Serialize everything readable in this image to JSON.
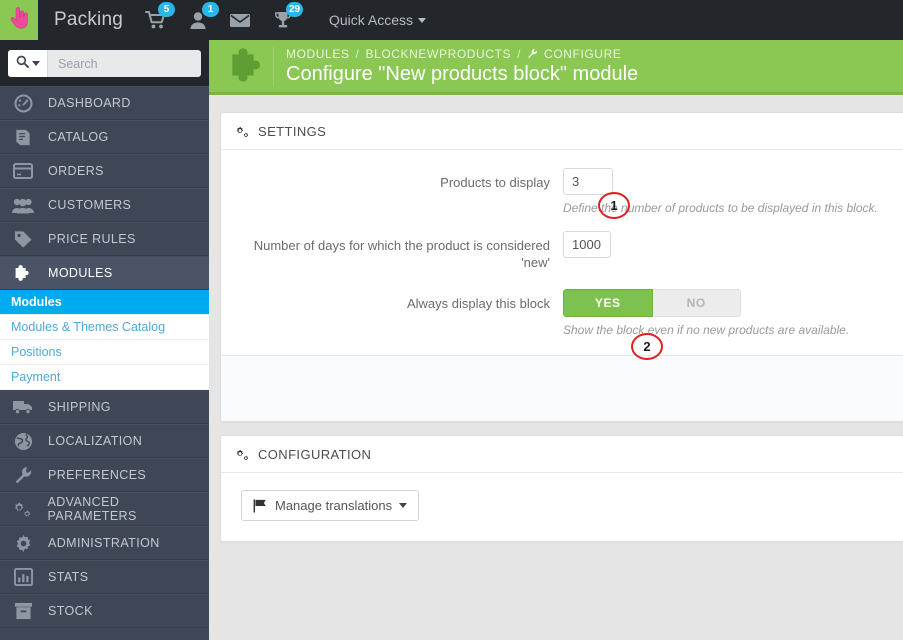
{
  "colors": {
    "topbar": "#23262b",
    "sidebar": "#3f4757",
    "brand_green": "#8bc753",
    "accent_blue": "#00aaf0",
    "badge_blue": "#29b6e8",
    "annotation_red": "#e02020",
    "switch_on_green": "#7dc24f"
  },
  "topbar": {
    "logo_icon": "hand-cursor-icon",
    "shop_name": "Packing",
    "icons": [
      {
        "name": "cart-icon",
        "badge": "5"
      },
      {
        "name": "person-icon",
        "badge": "1"
      },
      {
        "name": "envelope-icon",
        "badge": ""
      },
      {
        "name": "trophy-icon",
        "badge": "29"
      }
    ],
    "quick_access_label": "Quick Access"
  },
  "sidebar": {
    "search": {
      "placeholder": "Search",
      "value": "",
      "icon": "search-icon"
    },
    "items": [
      {
        "label": "DASHBOARD",
        "icon": "dashboard-icon",
        "active": false
      },
      {
        "label": "CATALOG",
        "icon": "book-icon",
        "active": false
      },
      {
        "label": "ORDERS",
        "icon": "card-icon",
        "active": false
      },
      {
        "label": "CUSTOMERS",
        "icon": "people-icon",
        "active": false
      },
      {
        "label": "PRICE RULES",
        "icon": "tag-icon",
        "active": false
      },
      {
        "label": "MODULES",
        "icon": "puzzle-icon",
        "active": true
      },
      {
        "label": "SHIPPING",
        "icon": "truck-icon",
        "active": false
      },
      {
        "label": "LOCALIZATION",
        "icon": "globe-icon",
        "active": false
      },
      {
        "label": "PREFERENCES",
        "icon": "wrench-icon",
        "active": false
      },
      {
        "label": "ADVANCED PARAMETERS",
        "icon": "gears-icon",
        "active": false
      },
      {
        "label": "ADMINISTRATION",
        "icon": "gear-icon",
        "active": false
      },
      {
        "label": "STATS",
        "icon": "bar-chart-icon",
        "active": false
      },
      {
        "label": "STOCK",
        "icon": "box-icon",
        "active": false
      }
    ],
    "submenu": [
      {
        "label": "Modules",
        "active": true
      },
      {
        "label": "Modules & Themes Catalog",
        "active": false
      },
      {
        "label": "Positions",
        "active": false
      },
      {
        "label": "Payment",
        "active": false
      }
    ]
  },
  "header": {
    "icon": "puzzle-icon",
    "breadcrumb": [
      {
        "label": "MODULES",
        "icon": ""
      },
      {
        "label": "BLOCKNEWPRODUCTS",
        "icon": ""
      },
      {
        "label": "CONFIGURE",
        "icon": "wrench-icon"
      }
    ],
    "separator": "/",
    "title": "Configure \"New products block\" module"
  },
  "settings_panel": {
    "icon": "gears-icon",
    "title": "SETTINGS",
    "fields": [
      {
        "label": "Products to display",
        "value": "3",
        "help": "Define the number of products to be displayed in this block.",
        "type": "number"
      },
      {
        "label": "Number of days for which the product is considered 'new'",
        "value": "1000",
        "help": "",
        "type": "number"
      },
      {
        "label": "Always display this block",
        "type": "switch",
        "on_label": "YES",
        "off_label": "NO",
        "value": "YES",
        "help": "Show the block even if no new products are available."
      }
    ]
  },
  "configuration_panel": {
    "icon": "gears-icon",
    "title": "CONFIGURATION",
    "translations_button": {
      "label": "Manage translations",
      "icon": "flag-icon"
    }
  },
  "annotations": [
    {
      "number": "1"
    },
    {
      "number": "2"
    }
  ]
}
